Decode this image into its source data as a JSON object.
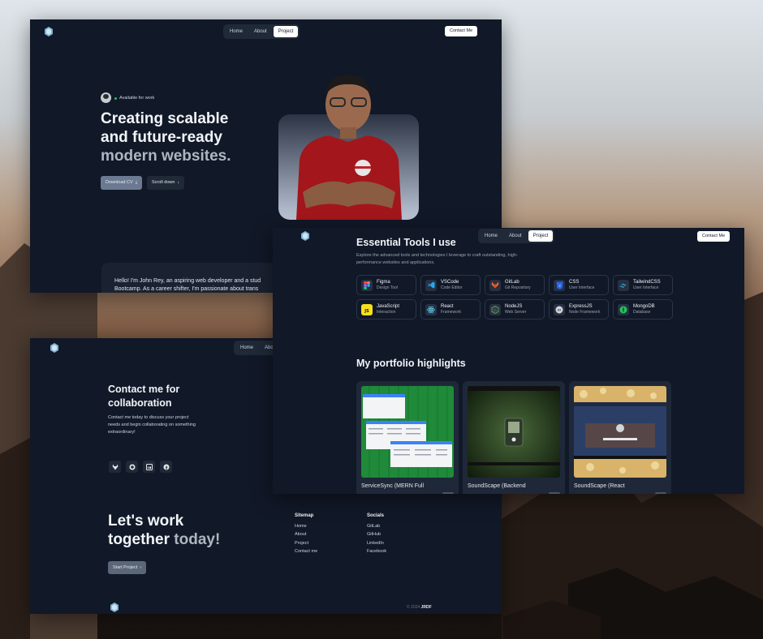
{
  "brand": {
    "accent": "#111827",
    "button_gray": "#6b7a92",
    "nav_bg": "#1f2937"
  },
  "hero": {
    "nav": {
      "home": "Home",
      "about": "About",
      "project": "Project"
    },
    "contact_button": "Contact Me",
    "status": "Available for work",
    "title_line1": "Creating scalable",
    "title_line2": "and future-ready",
    "title_line3": "modern websites.",
    "download_cv": "Download CV",
    "scroll_down": "Scroll down",
    "about_line1": "Hello! I'm John Rey, an aspiring web developer and a stud",
    "about_line2": "Bootcamp. As a career shifter, I'm passionate about trans"
  },
  "tools": {
    "nav": {
      "home": "Home",
      "about": "About",
      "project": "Project"
    },
    "contact_button": "Contact Me",
    "title": "Essential Tools I use",
    "description": "Explore the advanced tools and technologies I leverage to craft outstanding, high-performance websites and applications.",
    "items": [
      {
        "name": "Figma",
        "category": "Design Tool",
        "icon": "figma-icon"
      },
      {
        "name": "VSCode",
        "category": "Code Editor",
        "icon": "vscode-icon"
      },
      {
        "name": "GitLab",
        "category": "Git Repository",
        "icon": "gitlab-icon"
      },
      {
        "name": "CSS",
        "category": "User Interface",
        "icon": "css-icon"
      },
      {
        "name": "TailwindCSS",
        "category": "User Interface",
        "icon": "tailwind-icon"
      },
      {
        "name": "JavaScript",
        "category": "Interaction",
        "icon": "javascript-icon"
      },
      {
        "name": "React",
        "category": "Framework",
        "icon": "react-icon"
      },
      {
        "name": "NodeJS",
        "category": "Web Server",
        "icon": "nodejs-icon"
      },
      {
        "name": "ExpressJS",
        "category": "Node Framework",
        "icon": "expressjs-icon"
      },
      {
        "name": "MongoDB",
        "category": "Database",
        "icon": "mongodb-icon"
      }
    ],
    "portfolio_title": "My portfolio highlights",
    "projects": [
      {
        "title": "ServiceSync (MERN Full"
      },
      {
        "title": "SoundScape (Backend"
      },
      {
        "title": "SoundScape (React"
      }
    ]
  },
  "contact": {
    "nav": {
      "home": "Home",
      "about": "Abou"
    },
    "title": "Contact me for collaboration",
    "description": "Contact me today to discuss your project needs and begin collaborating on something extraordinary!",
    "socials_icons": [
      "gitlab-icon",
      "github-icon",
      "linkedin-icon",
      "facebook-icon"
    ],
    "lets_line1": "Let's work",
    "lets_line2a": "together",
    "lets_line2b": " today!",
    "start_project": "Start Project",
    "sitemap": {
      "title": "Sitemap",
      "links": [
        "Home",
        "About",
        "Project",
        "Contact me"
      ]
    },
    "socials": {
      "title": "Socials",
      "links": [
        "GitLab",
        "GitHub",
        "LinkedIn",
        "Facebook"
      ]
    },
    "copyright_prefix": "© 2024 ",
    "copyright_brand": "JRDF"
  }
}
